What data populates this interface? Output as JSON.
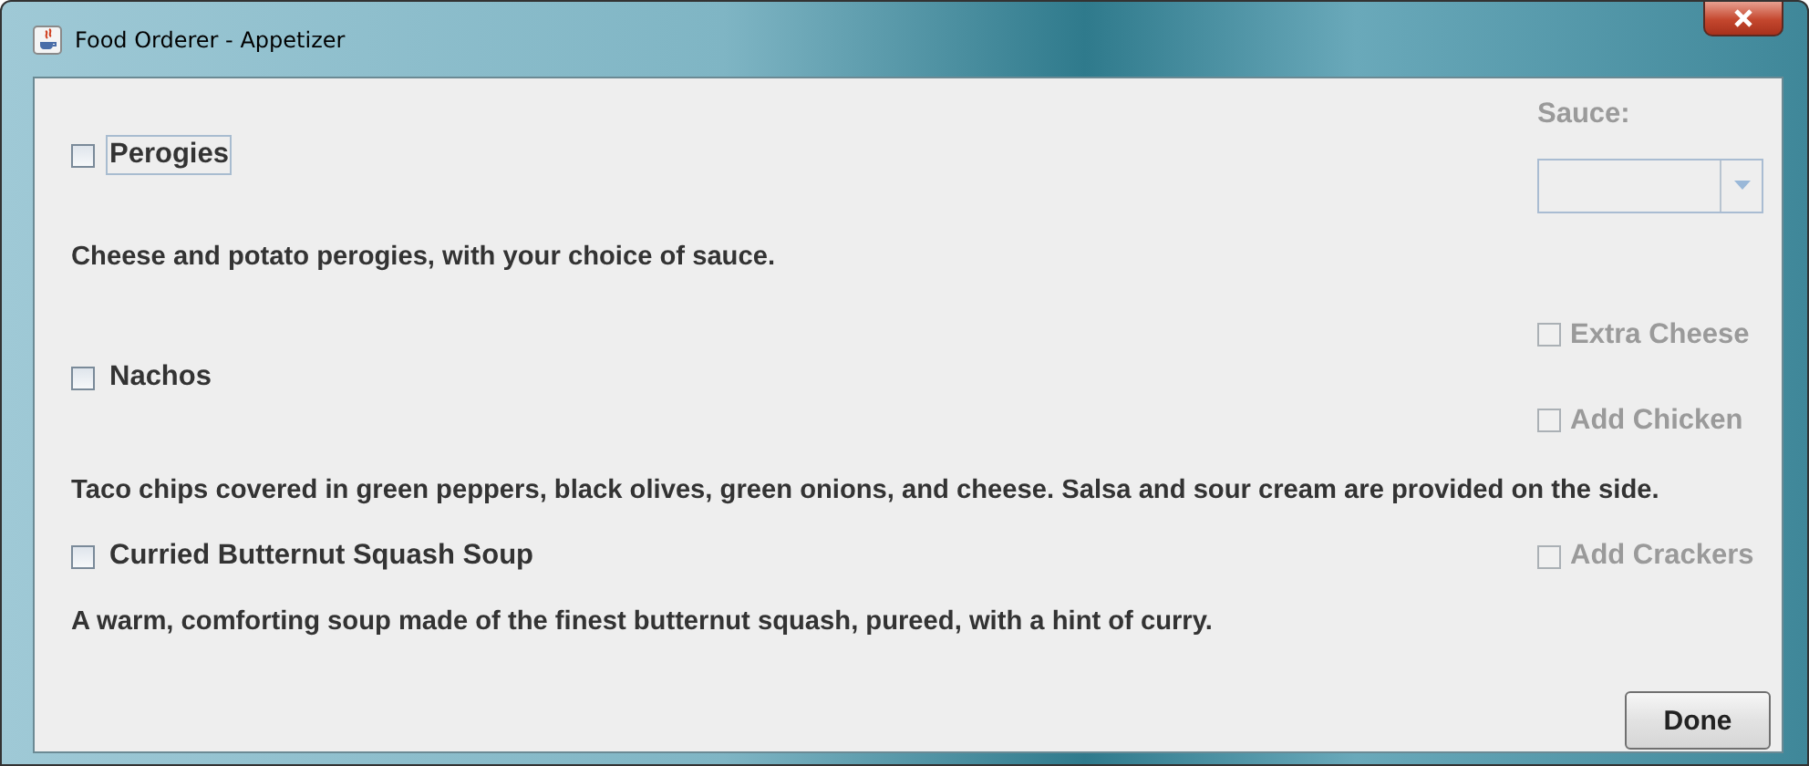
{
  "window": {
    "title": "Food Orderer - Appetizer"
  },
  "items": [
    {
      "name": "Perogies",
      "checked": false,
      "focused": true,
      "description": "Cheese and potato perogies, with your choice of sauce.",
      "options": [
        {
          "kind": "dropdown",
          "label": "Sauce:",
          "disabled": true
        }
      ]
    },
    {
      "name": "Nachos",
      "checked": false,
      "focused": false,
      "description": "Taco chips covered in green peppers, black olives, green onions, and cheese. Salsa and sour cream are provided on the side.",
      "options": [
        {
          "kind": "checkbox",
          "label": "Extra Cheese",
          "checked": false,
          "disabled": true
        },
        {
          "kind": "checkbox",
          "label": "Add Chicken",
          "checked": false,
          "disabled": true
        }
      ]
    },
    {
      "name": "Curried Butternut Squash Soup",
      "checked": false,
      "focused": false,
      "description": "A warm, comforting soup made of the finest butternut squash, pureed, with a hint of curry.",
      "options": [
        {
          "kind": "checkbox",
          "label": "Add Crackers",
          "checked": false,
          "disabled": true
        }
      ]
    }
  ],
  "buttons": [
    {
      "label": "Done"
    }
  ]
}
